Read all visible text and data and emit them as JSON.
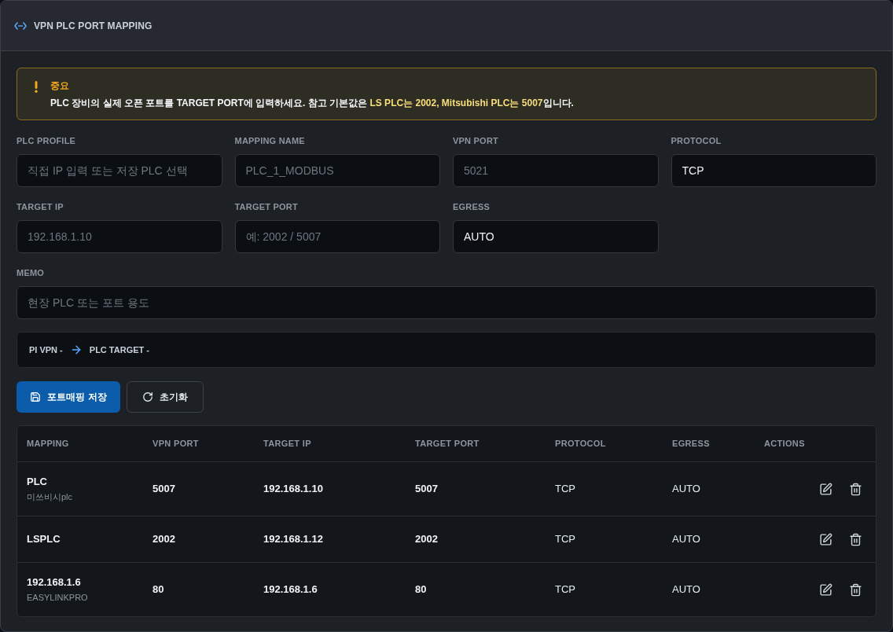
{
  "header": {
    "title": "VPN PLC PORT MAPPING"
  },
  "notice": {
    "title": "중요",
    "message": "PLC 장비의 실제 오픈 포트를 TARGET PORT에 입력하세요. 참고 기본값은 **LS PLC는 2002, Mitsubishi PLC는 5007**입니다."
  },
  "form": {
    "fields": [
      {
        "label": "PLC PROFILE",
        "placeholder": "직접 IP 입력 또는 저장 PLC 선택"
      },
      {
        "label": "MAPPING NAME",
        "placeholder": "PLC_1_MODBUS"
      },
      {
        "label": "VPN PORT",
        "placeholder": "5021"
      },
      {
        "label": "PROTOCOL",
        "value": "TCP"
      },
      {
        "label": "TARGET IP",
        "placeholder": "192.168.1.10"
      },
      {
        "label": "TARGET PORT",
        "placeholder": "예: 2002 / 5007"
      },
      {
        "label": "EGRESS",
        "value": "AUTO"
      }
    ],
    "memo": {
      "label": "MEMO",
      "placeholder": "현장 PLC 또는 포트 용도"
    }
  },
  "route": {
    "source": "PI VPN -",
    "target": "PLC TARGET -"
  },
  "buttons": [
    {
      "label": "포트매핑 저장",
      "kind": "primary"
    },
    {
      "label": "초기화",
      "kind": "secondary"
    }
  ],
  "table": {
    "columns": [
      "MAPPING",
      "VPN PORT",
      "TARGET IP",
      "TARGET PORT",
      "PROTOCOL",
      "EGRESS",
      "ACTIONS"
    ],
    "rows": [
      {
        "mapping": "PLC",
        "note": "미쓰비시plc",
        "vpn_port": "5007",
        "target_ip": "192.168.1.10",
        "target_port": "5007",
        "protocol": "TCP",
        "egress": "AUTO"
      },
      {
        "mapping": "LSPLC",
        "vpn_port": "2002",
        "target_ip": "192.168.1.12",
        "target_port": "2002",
        "protocol": "TCP",
        "egress": "AUTO"
      },
      {
        "mapping": "192.168.1.6",
        "note": "EASYLINKPRO",
        "vpn_port": "80",
        "target_ip": "192.168.1.6",
        "target_port": "80",
        "protocol": "TCP",
        "egress": "AUTO"
      }
    ]
  }
}
